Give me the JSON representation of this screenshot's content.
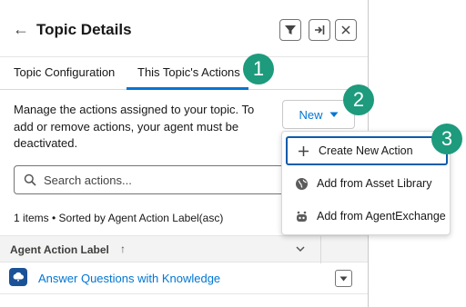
{
  "header": {
    "title": "Topic Details",
    "back_icon": "arrow-left-icon"
  },
  "header_buttons": [
    "filter-icon",
    "collapse-panel-icon",
    "close-icon"
  ],
  "tabs": [
    {
      "label": "Topic Configuration",
      "active": false
    },
    {
      "label": "This Topic's Actions",
      "active": true
    }
  ],
  "description": "Manage the actions assigned to your topic. To add or remove actions, your agent must be deactivated.",
  "new_button": {
    "label": "New"
  },
  "search": {
    "placeholder": "Search actions...",
    "value": ""
  },
  "list_meta": "1 items • Sorted by Agent Action Label(asc)",
  "table": {
    "column_header": "Agent Action Label",
    "sort_indicator": "↑",
    "rows": [
      {
        "label": "Answer Questions with Knowledge"
      }
    ]
  },
  "dropdown": {
    "items": [
      {
        "label": "Create New Action",
        "icon": "plus-icon",
        "focused": true
      },
      {
        "label": "Add from Asset Library",
        "icon": "globe-icon",
        "focused": false
      },
      {
        "label": "Add from AgentExchange",
        "icon": "agent-icon",
        "focused": false
      }
    ]
  },
  "callouts": [
    "1",
    "2",
    "3"
  ],
  "colors": {
    "accent": "#0176d3",
    "callout": "#1d9b7c",
    "icon_bg": "#1b5297"
  }
}
